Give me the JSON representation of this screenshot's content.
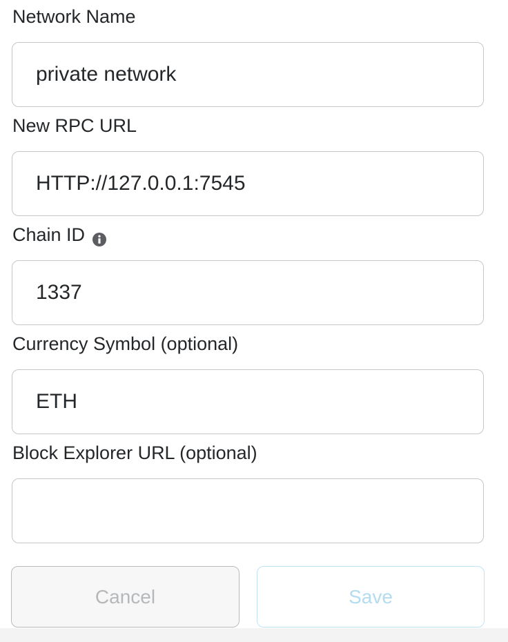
{
  "form": {
    "fields": [
      {
        "label": "Network Name",
        "value": "private network",
        "placeholder": ""
      },
      {
        "label": "New RPC URL",
        "value": "HTTP://127.0.0.1:7545",
        "placeholder": ""
      },
      {
        "label": "Chain ID",
        "value": "1337",
        "placeholder": "",
        "info_icon": "info-icon"
      },
      {
        "label": "Currency Symbol (optional)",
        "value": "ETH",
        "placeholder": ""
      },
      {
        "label": "Block Explorer URL (optional)",
        "value": "",
        "placeholder": ""
      }
    ]
  },
  "actions": {
    "cancel_label": "Cancel",
    "save_label": "Save"
  },
  "colors": {
    "text": "#24272a",
    "input_border": "#c4c7ca",
    "cancel_text": "#b5b8bb",
    "save_text": "#b3dcf0",
    "save_border": "#bfe3f4"
  }
}
